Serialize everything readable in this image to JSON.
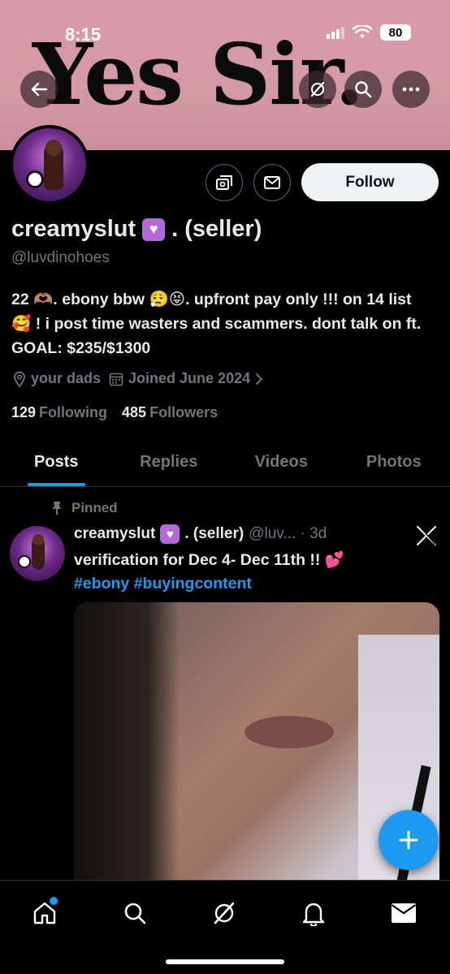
{
  "status_bar": {
    "time": "8:15",
    "battery": "80"
  },
  "banner": {
    "text": "Yes Sir."
  },
  "profile": {
    "display_name": "creamyslut",
    "display_name_suffix": ". (seller)",
    "handle": "@luvdinohoes",
    "bio": "22 🫶🏽. ebony bbw 😮‍💨😝. upfront pay only !!! on 14 list 🥰 ! i post time wasters and scammers. dont talk on ft. GOAL: $235/$1300",
    "location": "your dads",
    "joined": "Joined June 2024",
    "following_count": "129",
    "following_label": "Following",
    "followers_count": "485",
    "followers_label": "Followers",
    "follow_label": "Follow"
  },
  "tabs": [
    {
      "label": "Posts",
      "active": true
    },
    {
      "label": "Replies"
    },
    {
      "label": "Videos"
    },
    {
      "label": "Photos"
    }
  ],
  "post": {
    "pinned_label": "Pinned",
    "name": "creamyslut",
    "name_suffix": ". (seller)",
    "handle_time": "@luv... · 3d",
    "text": "verification for Dec 4- Dec 11th !! 💕",
    "hashtag_1": "#ebony",
    "hashtag_2": "#buyingcontent"
  },
  "colors": {
    "accent": "#1d9bf0",
    "banner": "#d99aa8",
    "badge": "#b36ad6"
  },
  "icons": [
    "back-icon",
    "grok-icon",
    "search-icon",
    "more-icon",
    "subscribe-icon",
    "message-icon",
    "location-icon",
    "calendar-icon",
    "pin-icon",
    "x-logo-icon",
    "plus-icon",
    "home-icon",
    "bell-icon",
    "mail-icon"
  ]
}
